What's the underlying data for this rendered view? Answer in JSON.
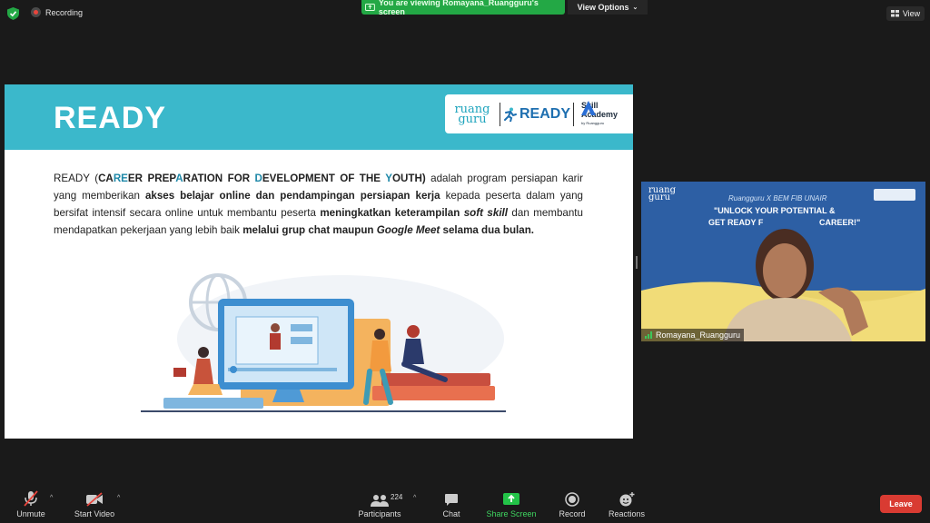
{
  "topbar": {
    "recording_label": "Recording",
    "viewing_label": "You are viewing Romayana_Ruangguru's screen",
    "view_options_label": "View Options",
    "view_label": "View"
  },
  "slide": {
    "title": "READY",
    "logo_ruangguru_top": "ruang",
    "logo_ruangguru_bottom": "guru",
    "logo_ready": "READY",
    "logo_skill": "Skill",
    "logo_academy": "Academy",
    "logo_by": "by Ruangguru",
    "p1": "READY (",
    "ca": "CA",
    "re": "RE",
    "er": "ER PREP",
    "a": "A",
    "ration": "RATION FOR ",
    "d": "D",
    "evelopment": "EVELOPMENT OF THE ",
    "y": "Y",
    "outh": "OUTH)",
    "p2": " adalah  program persiapan karir yang memberikan ",
    "b1": "akses belajar online dan pendampingan persiapan kerja",
    "p3": " kepada peserta dalam yang bersifat intensif secara online untuk membantu peserta ",
    "b2": "meningkatkan keterampilan ",
    "b2i": "soft skill",
    "p4": " dan membantu mendapatkan pekerjaan yang lebih baik ",
    "b3": "melalui grup chat maupun ",
    "b3i": "Google Meet",
    "b4": " selama dua bulan."
  },
  "video": {
    "banner_logo_top": "ruang",
    "banner_logo_bottom": "guru",
    "banner_subtitle": "Ruangguru X BEM FIB UNAIR",
    "banner_line1": "\"UNLOCK YOUR POTENTIAL &",
    "banner_line2": "GET READY F",
    "banner_line3": "CAREER!\"",
    "participant_name": "Romayana_Ruangguru"
  },
  "toolbar": {
    "unmute": "Unmute",
    "start_video": "Start Video",
    "participants_count": "224",
    "participants": "Participants",
    "chat": "Chat",
    "share_screen": "Share Screen",
    "record": "Record",
    "reactions": "Reactions",
    "leave": "Leave"
  },
  "colors": {
    "share_green": "#23a845",
    "slide_header": "#3bb8cb",
    "leave_red": "#d93b32"
  }
}
